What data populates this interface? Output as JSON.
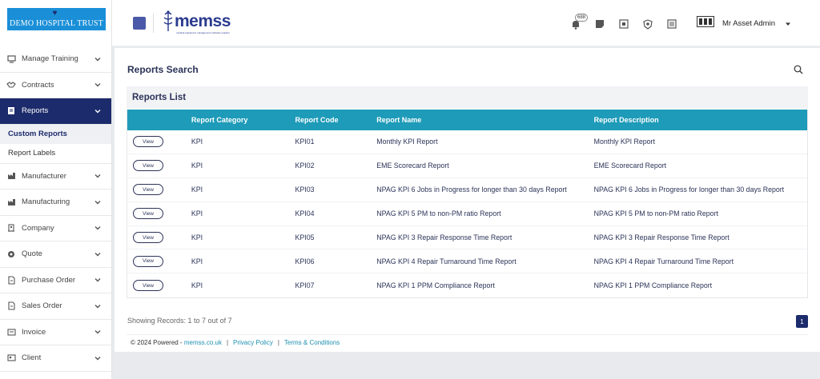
{
  "logo": {
    "text": "DEMO HOSPITAL TRUST"
  },
  "header": {
    "brand": "memss",
    "brand_tagline": "medical equipment management software solution",
    "notification_count": "688",
    "user_name": "Mr Asset Admin"
  },
  "sidebar": {
    "items": [
      {
        "label": "Manage Training",
        "icon": "monitor-icon"
      },
      {
        "label": "Contracts",
        "icon": "handshake-icon"
      },
      {
        "label": "Reports",
        "icon": "report-icon",
        "active": true
      },
      {
        "label": "Manufacturer",
        "icon": "factory-icon"
      },
      {
        "label": "Manufacturing",
        "icon": "factory-icon"
      },
      {
        "label": "Company",
        "icon": "building-icon"
      },
      {
        "label": "Quote",
        "icon": "quote-icon"
      },
      {
        "label": "Purchase Order",
        "icon": "document-icon"
      },
      {
        "label": "Sales Order",
        "icon": "document-icon"
      },
      {
        "label": "Invoice",
        "icon": "invoice-icon"
      },
      {
        "label": "Client",
        "icon": "client-icon"
      }
    ],
    "sub_items": [
      {
        "label": "Custom Reports"
      },
      {
        "label": "Report Labels"
      }
    ]
  },
  "main": {
    "page_title": "Reports Search",
    "list_title": "Reports List",
    "columns": [
      "",
      "Report Category",
      "Report Code",
      "Report Name",
      "Report Description"
    ],
    "view_label": "View",
    "rows": [
      {
        "category": "KPI",
        "code": "KPI01",
        "name": "Monthly KPI Report",
        "description": "Monthly KPI Report"
      },
      {
        "category": "KPI",
        "code": "KPI02",
        "name": "EME Scorecard Report",
        "description": "EME Scorecard Report"
      },
      {
        "category": "KPI",
        "code": "KPI03",
        "name": "NPAG KPI 6 Jobs in Progress for longer than 30 days Report",
        "description": "NPAG KPI 6 Jobs in Progress for longer than 30 days Report"
      },
      {
        "category": "KPI",
        "code": "KPI04",
        "name": "NPAG KPI 5 PM to non-PM ratio Report",
        "description": "NPAG KPI 5 PM to non-PM ratio Report"
      },
      {
        "category": "KPI",
        "code": "KPI05",
        "name": "NPAG KPI 3 Repair Response Time Report",
        "description": "NPAG KPI 3 Repair Response Time Report"
      },
      {
        "category": "KPI",
        "code": "KPI06",
        "name": "NPAG KPI 4 Repair Turnaround Time Report",
        "description": "NPAG KPI 4 Repair Turnaround Time Report"
      },
      {
        "category": "KPI",
        "code": "KPI07",
        "name": "NPAG KPI 1 PPM Compliance Report",
        "description": "NPAG KPI 1 PPM Compliance Report"
      }
    ],
    "showing_text": "Showing Records: 1 to 7 out of 7",
    "current_page": "1"
  },
  "footer": {
    "copyright": "© 2024 Powered - ",
    "site_link": "memss.co.uk",
    "privacy": "Privacy Policy",
    "terms": "Terms & Conditions"
  },
  "colors": {
    "accent_navy": "#1c2b6b",
    "table_header": "#1e9bb8",
    "logo_bg": "#1a8fd8"
  }
}
